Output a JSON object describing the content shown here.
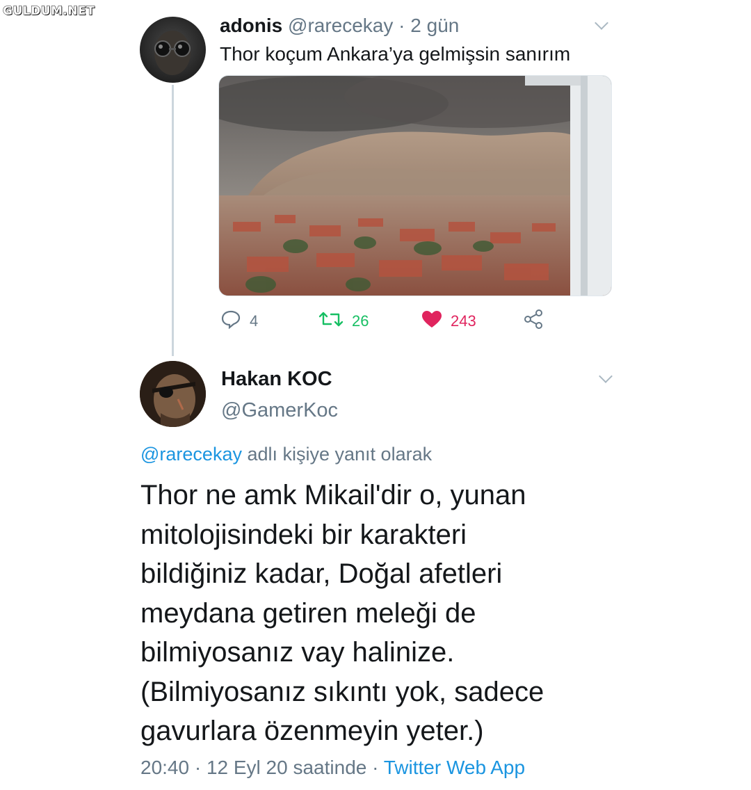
{
  "watermark": "GULDUM.NET",
  "tweet1": {
    "name": "adonis",
    "handle": "@rarecekay",
    "time": " · 2 gün",
    "text": "Thor koçum Ankara’ya gelmişsin sanırım",
    "image_icon": "photo-sandstorm-over-city",
    "counts": {
      "replies": "4",
      "retweets": "26",
      "likes": "243"
    }
  },
  "tweet2": {
    "name": "Hakan KOC",
    "handle": "@GamerKoc",
    "reply_handle": "@rarecekay",
    "reply_suffix": " adlı kişiye yanıt olarak",
    "lines": [
      "Thor ne amk Mikail'dir o, yunan",
      "mitolojisindeki bir karakteri",
      "bildiğiniz kadar, Doğal afetleri",
      "meydana getiren meleği de",
      "bilmiyosanız vay halinize.",
      "(Bilmiyosanız sıkıntı yok, sadece",
      "gavurlara özenmeyin yeter.)"
    ],
    "timestamp": "20:40 · 12 Eyl 20 saatinde · ",
    "source": "Twitter Web App"
  },
  "colors": {
    "link": "#1b95e0",
    "retweet": "#17bf63",
    "like": "#e0245e",
    "muted": "#657786"
  }
}
